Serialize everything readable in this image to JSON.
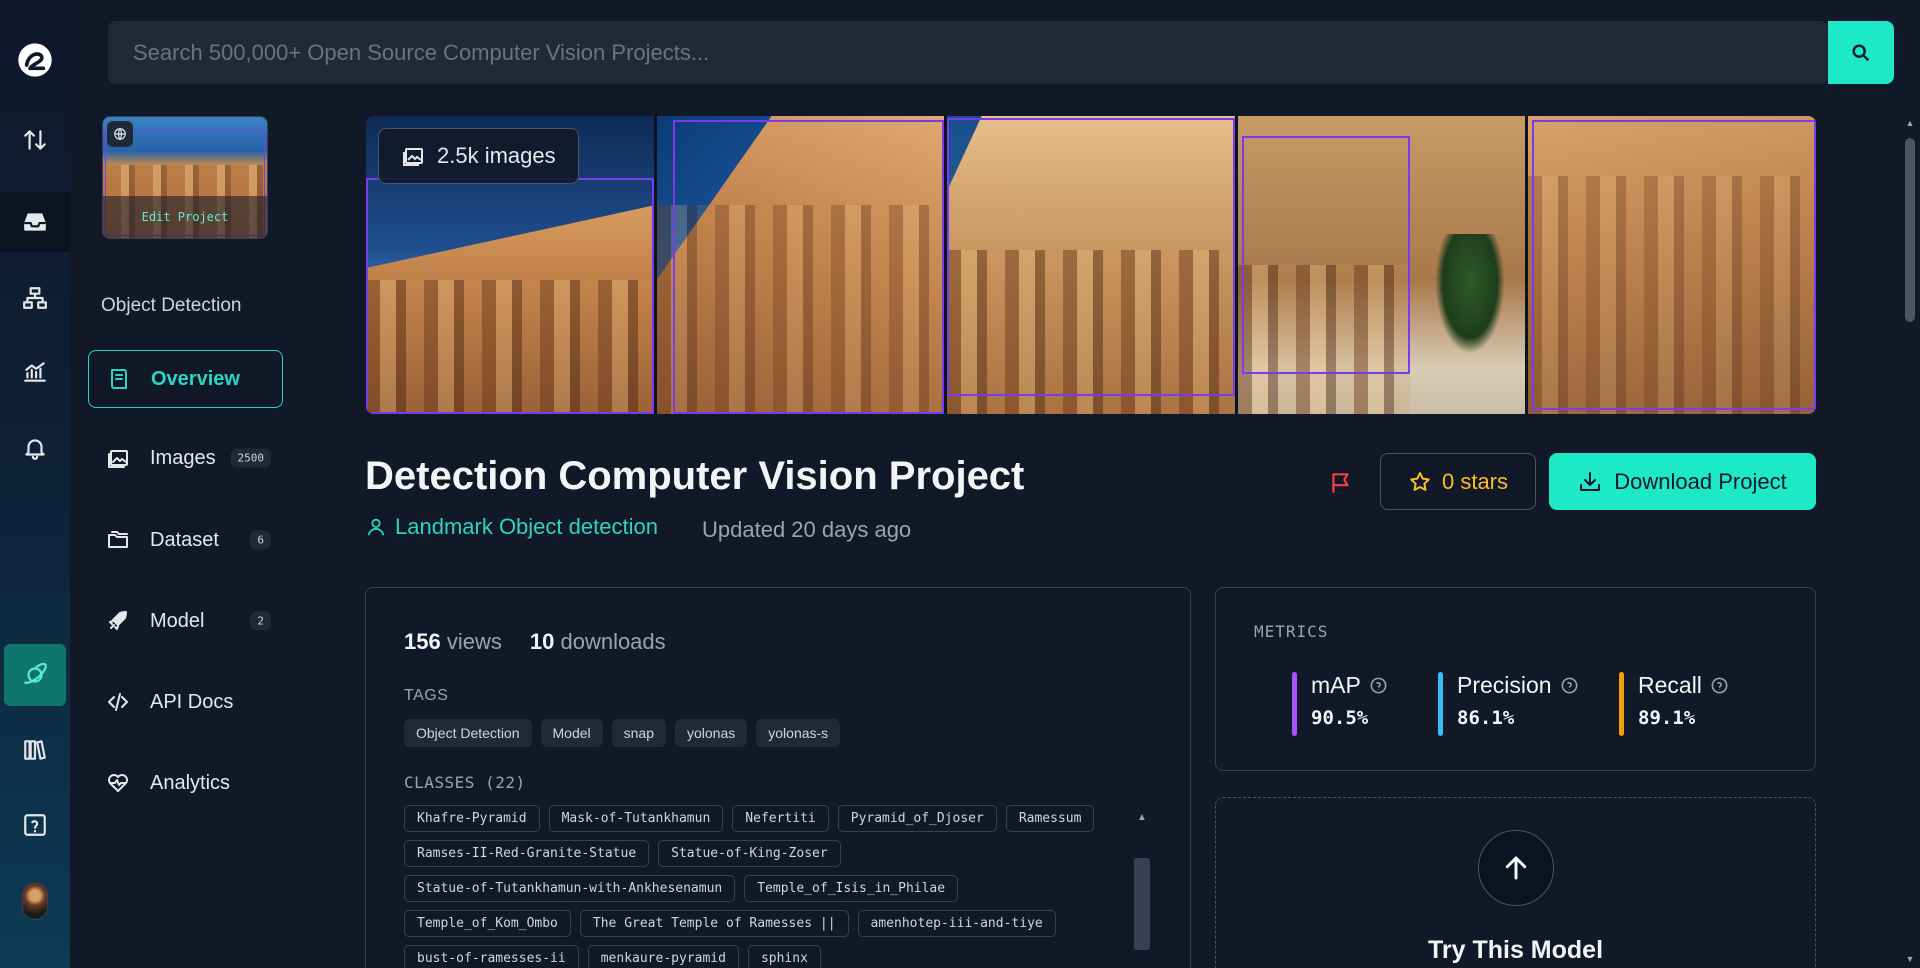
{
  "search": {
    "placeholder": "Search 500,000+ Open Source Computer Vision Projects..."
  },
  "rail": {
    "items": [
      "logo-icon",
      "sort-arrows-icon",
      "inbox-icon",
      "network-icon",
      "chart-icon",
      "bell-icon",
      "planet-icon",
      "books-icon",
      "help-icon",
      "user-avatar"
    ]
  },
  "sidebar": {
    "edit_label": "Edit Project",
    "project_type": "Object Detection",
    "nav": [
      {
        "label": "Overview",
        "count": ""
      },
      {
        "label": "Images",
        "count": "2500"
      },
      {
        "label": "Dataset",
        "count": "6"
      },
      {
        "label": "Model",
        "count": "2"
      },
      {
        "label": "API Docs",
        "count": ""
      },
      {
        "label": "Analytics",
        "count": ""
      }
    ]
  },
  "gallery": {
    "image_count": "2.5k images"
  },
  "project": {
    "title": "Detection Computer Vision Project",
    "author": "Landmark Object detection",
    "updated": "Updated 20 days ago",
    "stars_label": "0 stars",
    "download_label": "Download Project"
  },
  "stats": {
    "views": "156",
    "views_label": "views",
    "downloads": "10",
    "downloads_label": "downloads"
  },
  "tags": {
    "label": "TAGS",
    "items": [
      "Object Detection",
      "Model",
      "snap",
      "yolonas",
      "yolonas-s"
    ]
  },
  "classes": {
    "label": "CLASSES (22)",
    "items": [
      "Khafre-Pyramid",
      "Mask-of-Tutankhamun",
      "Nefertiti",
      "Pyramid_of_Djoser",
      "Ramessum",
      "Ramses-II-Red-Granite-Statue",
      "Statue-of-King-Zoser",
      "Statue-of-Tutankhamun-with-Ankhesenamun",
      "Temple_of_Isis_in_Philae",
      "Temple_of_Kom_Ombo",
      "The Great Temple of Ramesses ||",
      "amenhotep-iii-and-tiye",
      "bust-of-ramesses-ii",
      "menkaure-pyramid",
      "sphinx"
    ]
  },
  "metrics": {
    "label": "METRICS",
    "items": [
      {
        "name": "mAP",
        "value": "90.5%",
        "color": "#a855f7"
      },
      {
        "name": "Precision",
        "value": "86.1%",
        "color": "#38bdf8"
      },
      {
        "name": "Recall",
        "value": "89.1%",
        "color": "#f59e0b"
      }
    ]
  },
  "try_model": {
    "label": "Try This Model"
  },
  "colors": {
    "accent": "#1de9c6",
    "teal_text": "#2dd4bf",
    "bbox": "#7c3aed",
    "flag": "#ef4444",
    "star": "#fbbf24"
  }
}
